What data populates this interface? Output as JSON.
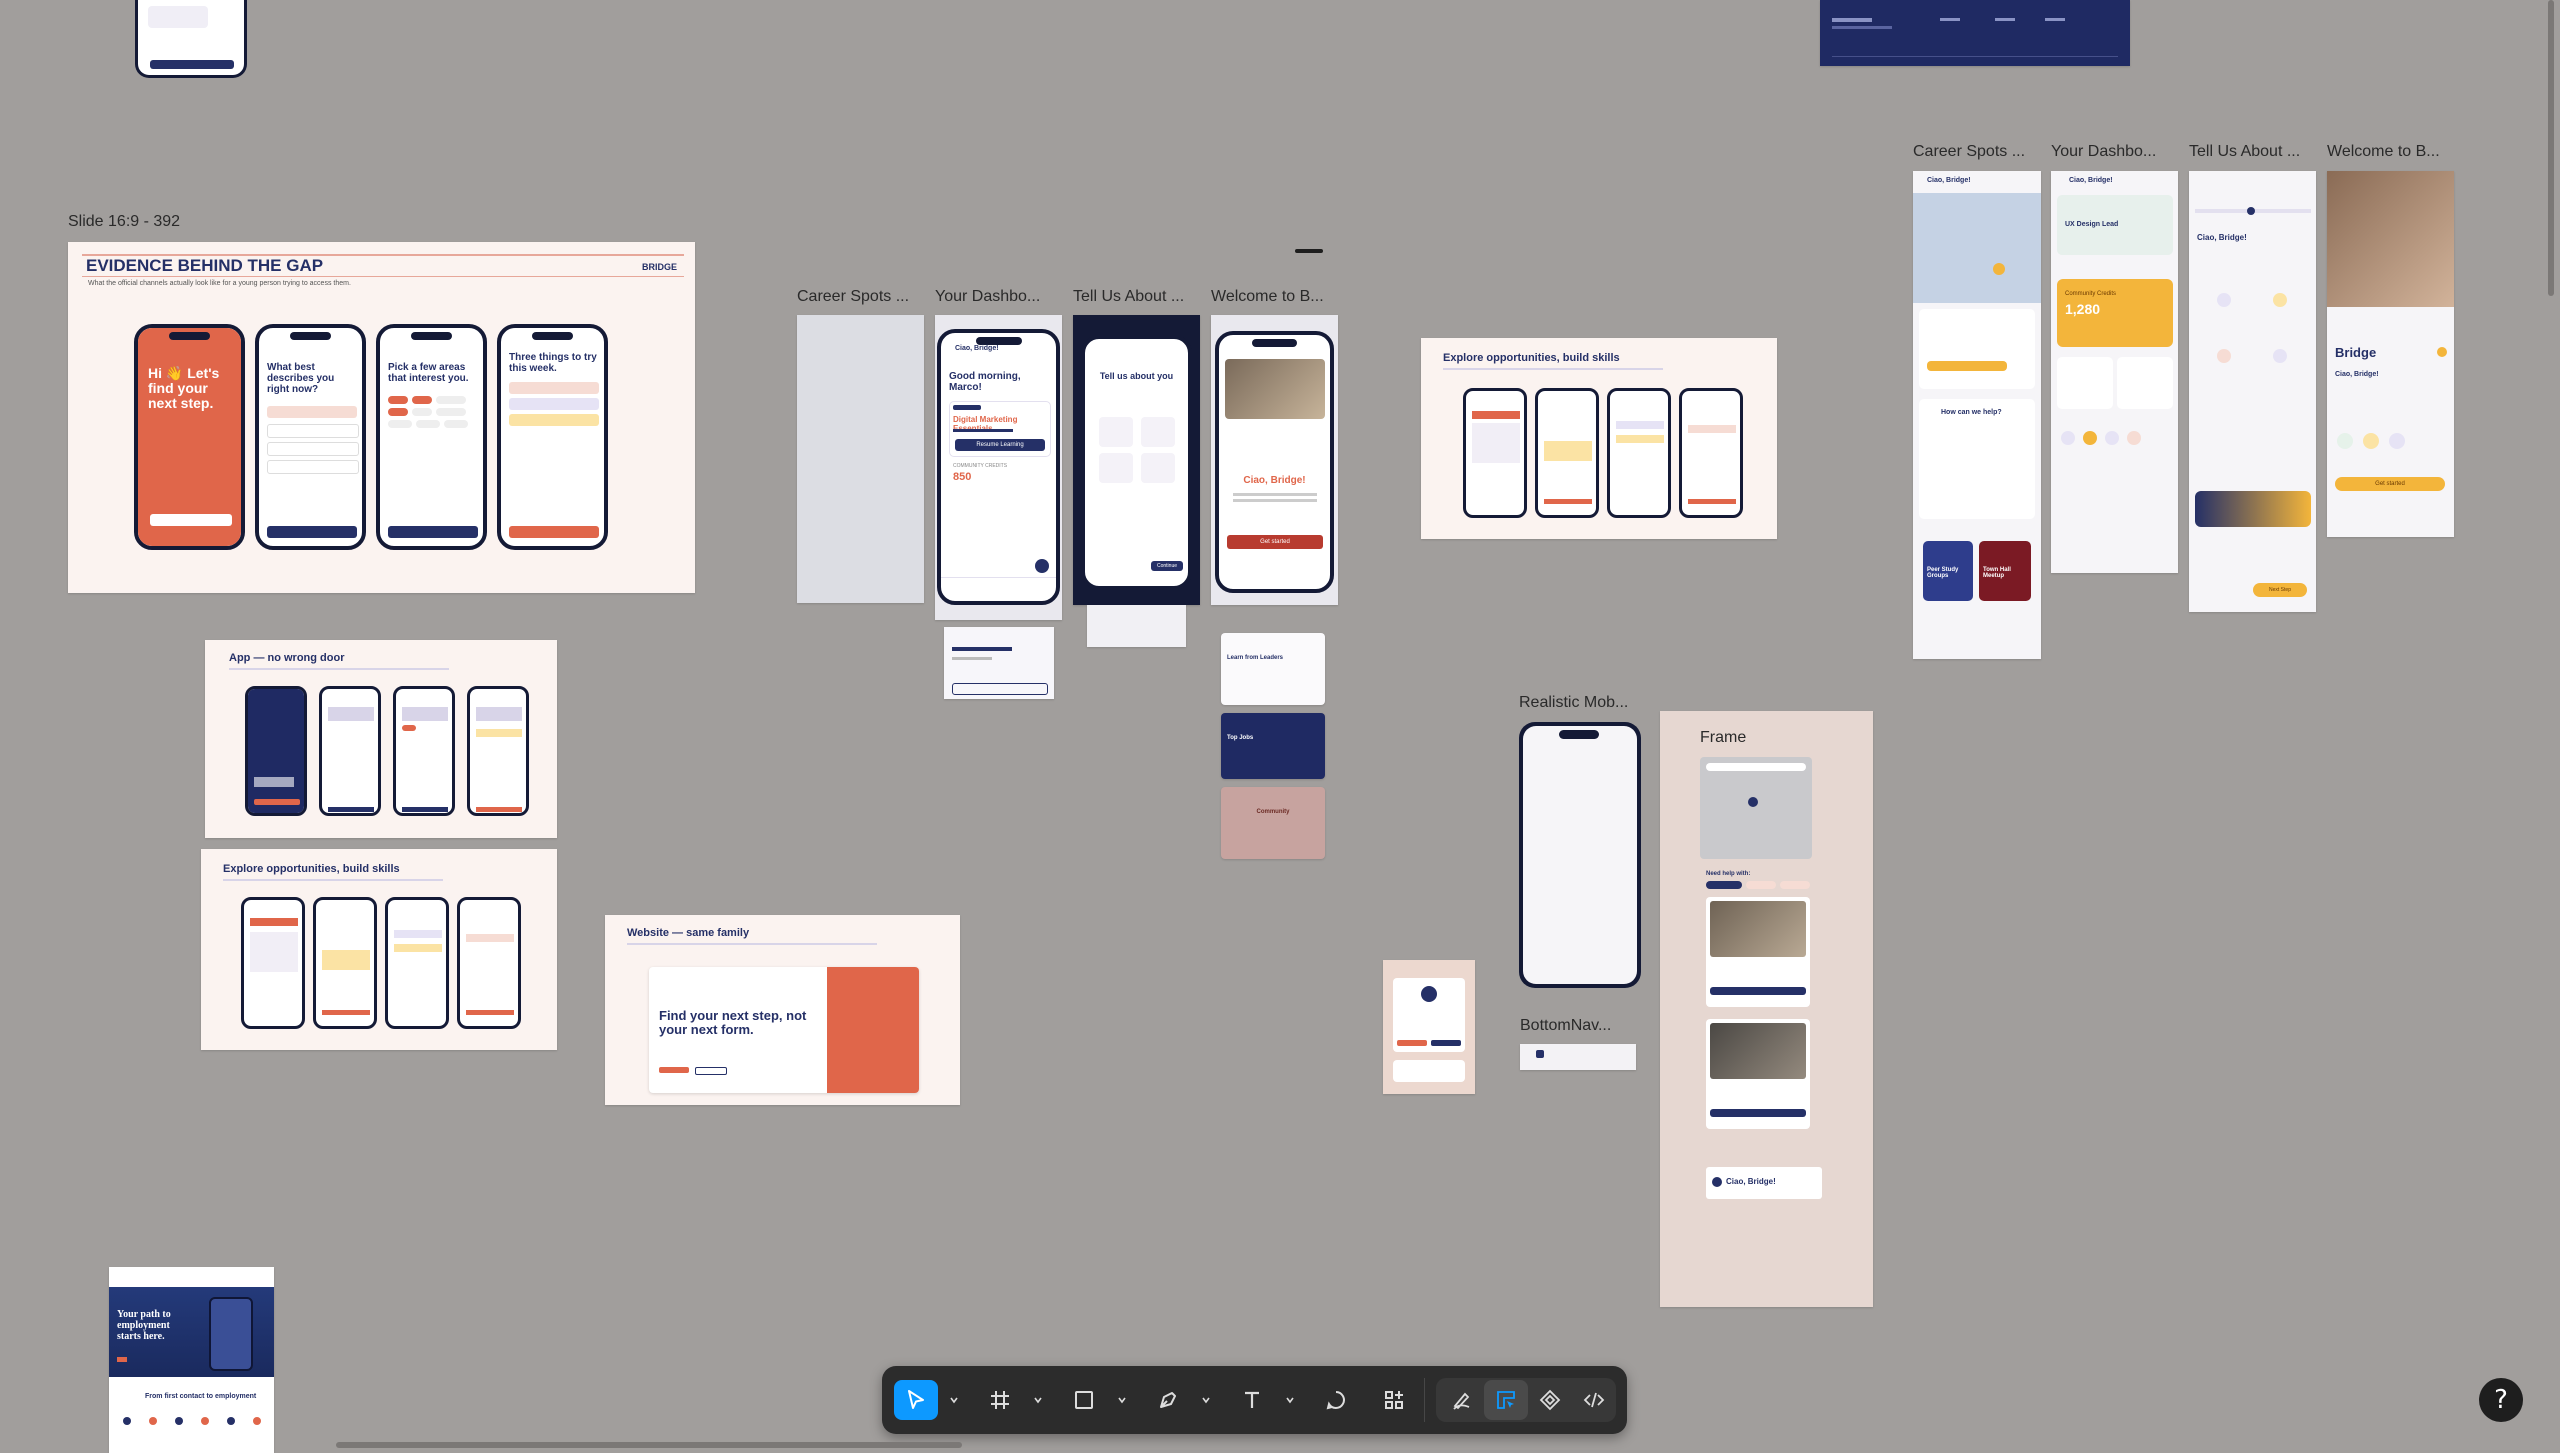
{
  "canvas": {
    "background": "#a19e9c",
    "frame_labels": {
      "slide_392": "Slide 16:9 - 392",
      "career_spots": "Career Spots ...",
      "your_dashboard": "Your Dashbo...",
      "tell_us_about": "Tell Us About ...",
      "welcome_to": "Welcome to B...",
      "career_spots_right": "Career Spots ...",
      "your_dashboard_right": "Your Dashbo...",
      "tell_us_about_right": "Tell Us About ...",
      "welcome_to_right": "Welcome to B...",
      "realistic_mobile": "Realistic Mob...",
      "bottom_nav": "BottomNav...",
      "frame": "Frame"
    }
  },
  "slides": {
    "evidence": {
      "title": "EVIDENCE BEHIND THE GAP",
      "subtitle": "What the official channels actually look like for a young person trying to access them.",
      "brand": "BRIDGE",
      "phone1_heading": "Hi 👋 Let's find your next step.",
      "phone2_heading": "What best describes you right now?",
      "phone3_heading": "Pick a few areas that interest you.",
      "phone4_heading": "Three things to try this week."
    },
    "app_door": {
      "title": "App — no wrong door"
    },
    "explore_left": {
      "title": "Explore opportunities, build skills"
    },
    "explore_center": {
      "title": "Explore opportunities, build skills"
    },
    "website": {
      "title": "Website — same family",
      "hero": "Find your next step, not your next form."
    },
    "web_preview": {
      "hero": "Your path to employment starts here.",
      "section": "From first contact to employment"
    }
  },
  "screens": {
    "dashboard_center": {
      "greeting_small": "Ciao, Bridge!",
      "headline": "Good morning, Marco!",
      "card_title": "Digital Marketing Essentials",
      "button": "Resume Learning",
      "credits_label": "COMMUNITY CREDITS",
      "credits_value": "850"
    },
    "tell_center": {
      "title": "Tell us about you",
      "button": "Continue"
    },
    "welcome_center": {
      "title": "Ciao, Bridge!",
      "button": "Get started"
    },
    "dash_right": {
      "greeting": "Ciao, Bridge!",
      "role": "UX Design Lead",
      "credits_label": "Community Credits",
      "credits_value": "1,280"
    },
    "career_right": {
      "greeting": "Ciao, Bridge!",
      "help_title": "How can we help?",
      "card1": "Peer Study Groups",
      "card2": "Town Hall Meetup"
    },
    "tell_right": {
      "title": "Ciao, Bridge!",
      "button": "Next Step"
    },
    "welcome_right": {
      "brand": "Bridge",
      "title": "Ciao, Bridge!",
      "button": "Get started"
    },
    "frame_panel": {
      "need_help": "Need help with:",
      "footer": "Ciao, Bridge!"
    },
    "cards": {
      "learn": "Learn from Leaders",
      "top_jobs": "Top Jobs",
      "community": "Community"
    }
  },
  "toolbar": {
    "tools": [
      "move-tool",
      "frame-tool",
      "shape-tool",
      "pen-tool",
      "text-tool",
      "comment-tool",
      "actions-tool"
    ],
    "active": "move-tool",
    "accent": "#0d99ff"
  },
  "help_label": "?"
}
